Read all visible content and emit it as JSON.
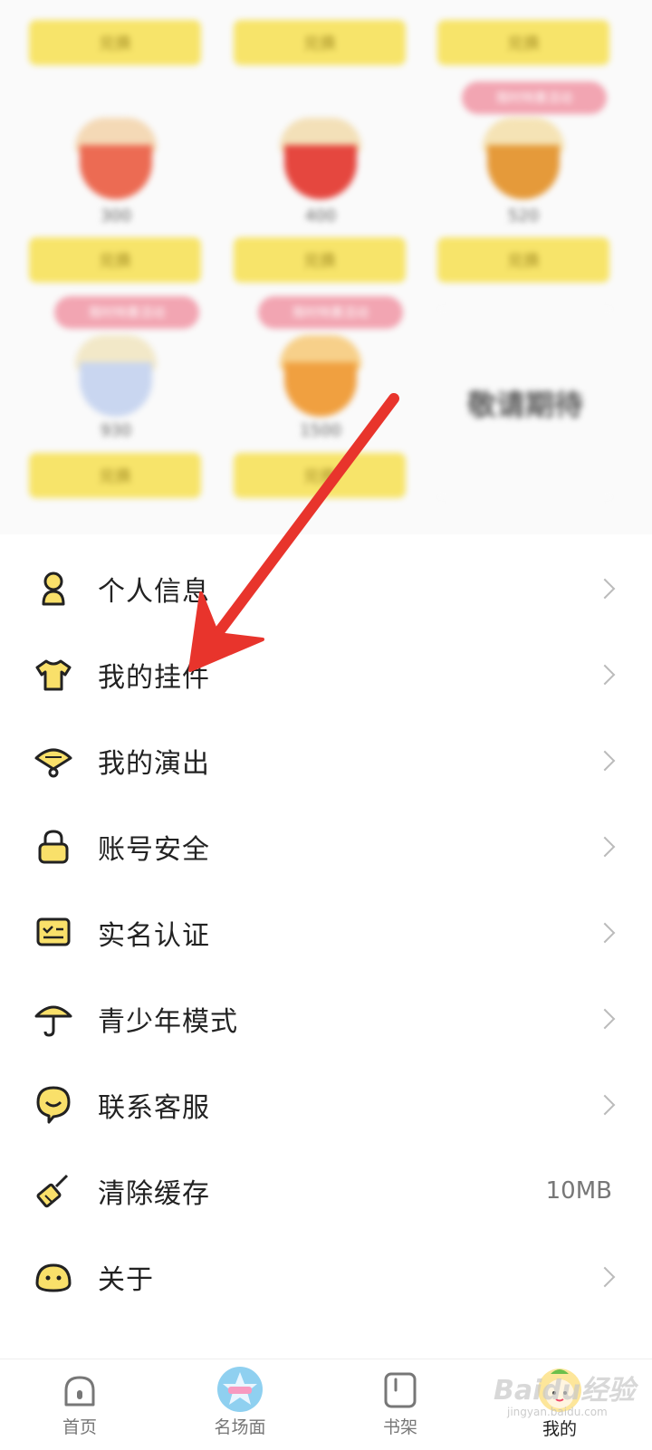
{
  "shop": {
    "buy_label": "兑换",
    "more_label": "敬请期待",
    "tag_label": "限时特惠活动",
    "prices": [
      "300",
      "400",
      "520",
      "930",
      "1500"
    ]
  },
  "menu": {
    "items": [
      {
        "label": "个人信息",
        "icon": "person-icon"
      },
      {
        "label": "我的挂件",
        "icon": "tshirt-icon"
      },
      {
        "label": "我的演出",
        "icon": "fan-icon"
      },
      {
        "label": "账号安全",
        "icon": "lock-icon"
      },
      {
        "label": "实名认证",
        "icon": "id-card-icon"
      },
      {
        "label": "青少年模式",
        "icon": "umbrella-icon"
      },
      {
        "label": "联系客服",
        "icon": "smile-chat-icon"
      },
      {
        "label": "清除缓存",
        "icon": "broom-icon",
        "value": "10MB"
      },
      {
        "label": "关于",
        "icon": "face-icon"
      }
    ]
  },
  "tabbar": {
    "tabs": [
      {
        "label": "首页",
        "icon": "home-icon",
        "active": false
      },
      {
        "label": "名场面",
        "icon": "star-badge-icon",
        "active": false
      },
      {
        "label": "书架",
        "icon": "bookshelf-icon",
        "active": false
      },
      {
        "label": "我的",
        "icon": "avatar-icon",
        "active": true
      }
    ]
  },
  "watermark": {
    "text": "Baidu经验",
    "sub": "jingyan.baidu.com"
  },
  "colors": {
    "accent": "#f7e46a",
    "icon_fill": "#f9e06a",
    "arrow": "#e8342c"
  }
}
